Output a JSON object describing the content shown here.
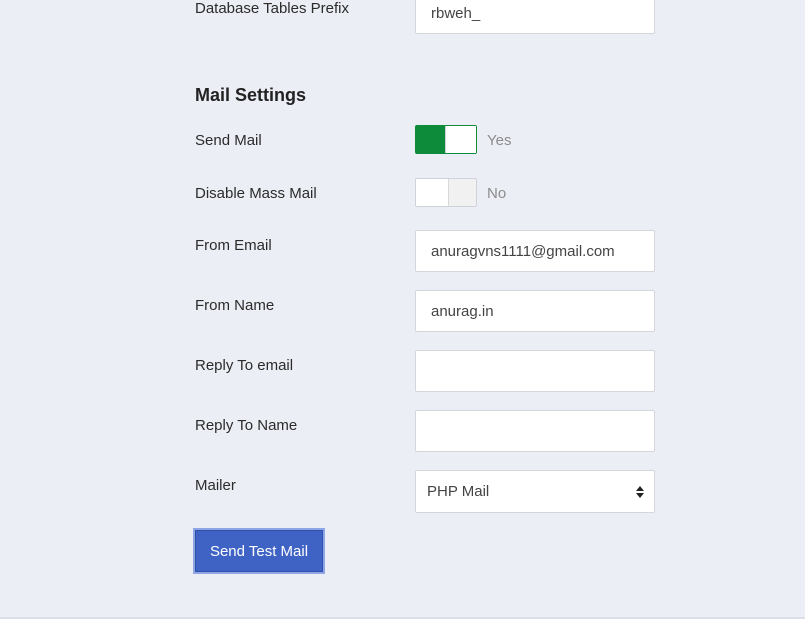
{
  "db": {
    "prefix_label": "Database Tables Prefix",
    "prefix_value": "rbweh_"
  },
  "mail": {
    "heading": "Mail Settings",
    "send_mail": {
      "label": "Send Mail",
      "state": "Yes",
      "on": true
    },
    "disable_mass_mail": {
      "label": "Disable Mass Mail",
      "state": "No",
      "on": false
    },
    "from_email": {
      "label": "From Email",
      "value": "anuragvns1111@gmail.com"
    },
    "from_name": {
      "label": "From Name",
      "value": "anurag.in"
    },
    "reply_to_email": {
      "label": "Reply To email",
      "value": ""
    },
    "reply_to_name": {
      "label": "Reply To Name",
      "value": ""
    },
    "mailer": {
      "label": "Mailer",
      "selected": "PHP Mail"
    },
    "send_test_label": "Send Test Mail"
  },
  "colors": {
    "background": "#eceef5",
    "toggle_on": "#0d8a3a",
    "button": "#3f63c4"
  }
}
